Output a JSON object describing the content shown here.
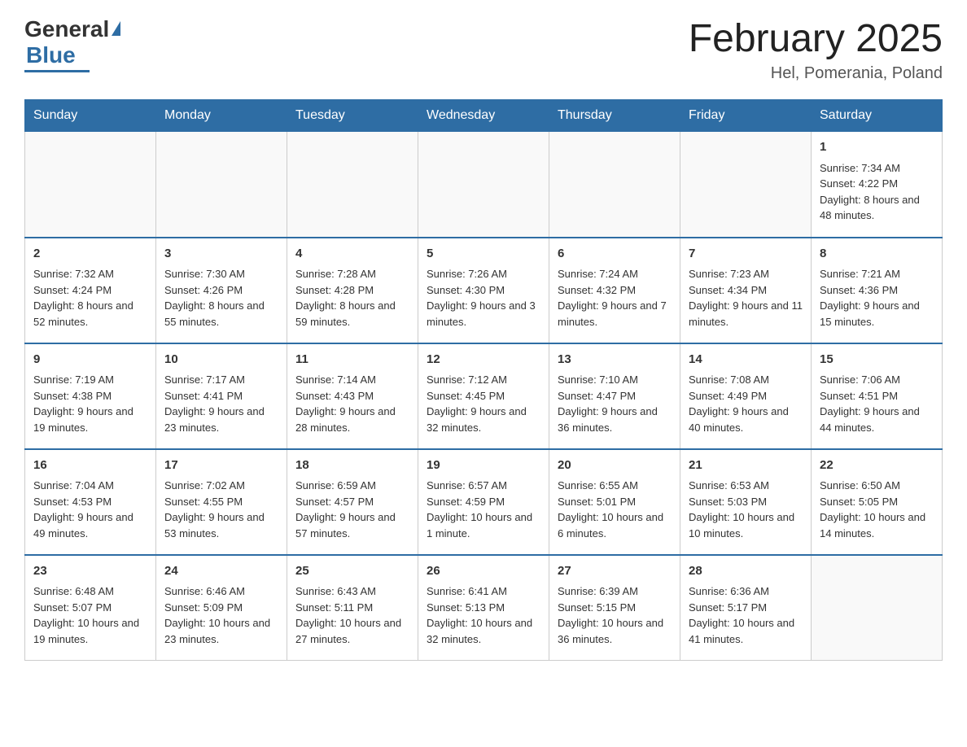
{
  "logo": {
    "brand": "General",
    "brand2": "Blue"
  },
  "title": "February 2025",
  "subtitle": "Hel, Pomerania, Poland",
  "days": [
    "Sunday",
    "Monday",
    "Tuesday",
    "Wednesday",
    "Thursday",
    "Friday",
    "Saturday"
  ],
  "weeks": [
    [
      {
        "day": "",
        "info": ""
      },
      {
        "day": "",
        "info": ""
      },
      {
        "day": "",
        "info": ""
      },
      {
        "day": "",
        "info": ""
      },
      {
        "day": "",
        "info": ""
      },
      {
        "day": "",
        "info": ""
      },
      {
        "day": "1",
        "info": "Sunrise: 7:34 AM\nSunset: 4:22 PM\nDaylight: 8 hours and 48 minutes."
      }
    ],
    [
      {
        "day": "2",
        "info": "Sunrise: 7:32 AM\nSunset: 4:24 PM\nDaylight: 8 hours and 52 minutes."
      },
      {
        "day": "3",
        "info": "Sunrise: 7:30 AM\nSunset: 4:26 PM\nDaylight: 8 hours and 55 minutes."
      },
      {
        "day": "4",
        "info": "Sunrise: 7:28 AM\nSunset: 4:28 PM\nDaylight: 8 hours and 59 minutes."
      },
      {
        "day": "5",
        "info": "Sunrise: 7:26 AM\nSunset: 4:30 PM\nDaylight: 9 hours and 3 minutes."
      },
      {
        "day": "6",
        "info": "Sunrise: 7:24 AM\nSunset: 4:32 PM\nDaylight: 9 hours and 7 minutes."
      },
      {
        "day": "7",
        "info": "Sunrise: 7:23 AM\nSunset: 4:34 PM\nDaylight: 9 hours and 11 minutes."
      },
      {
        "day": "8",
        "info": "Sunrise: 7:21 AM\nSunset: 4:36 PM\nDaylight: 9 hours and 15 minutes."
      }
    ],
    [
      {
        "day": "9",
        "info": "Sunrise: 7:19 AM\nSunset: 4:38 PM\nDaylight: 9 hours and 19 minutes."
      },
      {
        "day": "10",
        "info": "Sunrise: 7:17 AM\nSunset: 4:41 PM\nDaylight: 9 hours and 23 minutes."
      },
      {
        "day": "11",
        "info": "Sunrise: 7:14 AM\nSunset: 4:43 PM\nDaylight: 9 hours and 28 minutes."
      },
      {
        "day": "12",
        "info": "Sunrise: 7:12 AM\nSunset: 4:45 PM\nDaylight: 9 hours and 32 minutes."
      },
      {
        "day": "13",
        "info": "Sunrise: 7:10 AM\nSunset: 4:47 PM\nDaylight: 9 hours and 36 minutes."
      },
      {
        "day": "14",
        "info": "Sunrise: 7:08 AM\nSunset: 4:49 PM\nDaylight: 9 hours and 40 minutes."
      },
      {
        "day": "15",
        "info": "Sunrise: 7:06 AM\nSunset: 4:51 PM\nDaylight: 9 hours and 44 minutes."
      }
    ],
    [
      {
        "day": "16",
        "info": "Sunrise: 7:04 AM\nSunset: 4:53 PM\nDaylight: 9 hours and 49 minutes."
      },
      {
        "day": "17",
        "info": "Sunrise: 7:02 AM\nSunset: 4:55 PM\nDaylight: 9 hours and 53 minutes."
      },
      {
        "day": "18",
        "info": "Sunrise: 6:59 AM\nSunset: 4:57 PM\nDaylight: 9 hours and 57 minutes."
      },
      {
        "day": "19",
        "info": "Sunrise: 6:57 AM\nSunset: 4:59 PM\nDaylight: 10 hours and 1 minute."
      },
      {
        "day": "20",
        "info": "Sunrise: 6:55 AM\nSunset: 5:01 PM\nDaylight: 10 hours and 6 minutes."
      },
      {
        "day": "21",
        "info": "Sunrise: 6:53 AM\nSunset: 5:03 PM\nDaylight: 10 hours and 10 minutes."
      },
      {
        "day": "22",
        "info": "Sunrise: 6:50 AM\nSunset: 5:05 PM\nDaylight: 10 hours and 14 minutes."
      }
    ],
    [
      {
        "day": "23",
        "info": "Sunrise: 6:48 AM\nSunset: 5:07 PM\nDaylight: 10 hours and 19 minutes."
      },
      {
        "day": "24",
        "info": "Sunrise: 6:46 AM\nSunset: 5:09 PM\nDaylight: 10 hours and 23 minutes."
      },
      {
        "day": "25",
        "info": "Sunrise: 6:43 AM\nSunset: 5:11 PM\nDaylight: 10 hours and 27 minutes."
      },
      {
        "day": "26",
        "info": "Sunrise: 6:41 AM\nSunset: 5:13 PM\nDaylight: 10 hours and 32 minutes."
      },
      {
        "day": "27",
        "info": "Sunrise: 6:39 AM\nSunset: 5:15 PM\nDaylight: 10 hours and 36 minutes."
      },
      {
        "day": "28",
        "info": "Sunrise: 6:36 AM\nSunset: 5:17 PM\nDaylight: 10 hours and 41 minutes."
      },
      {
        "day": "",
        "info": ""
      }
    ]
  ]
}
